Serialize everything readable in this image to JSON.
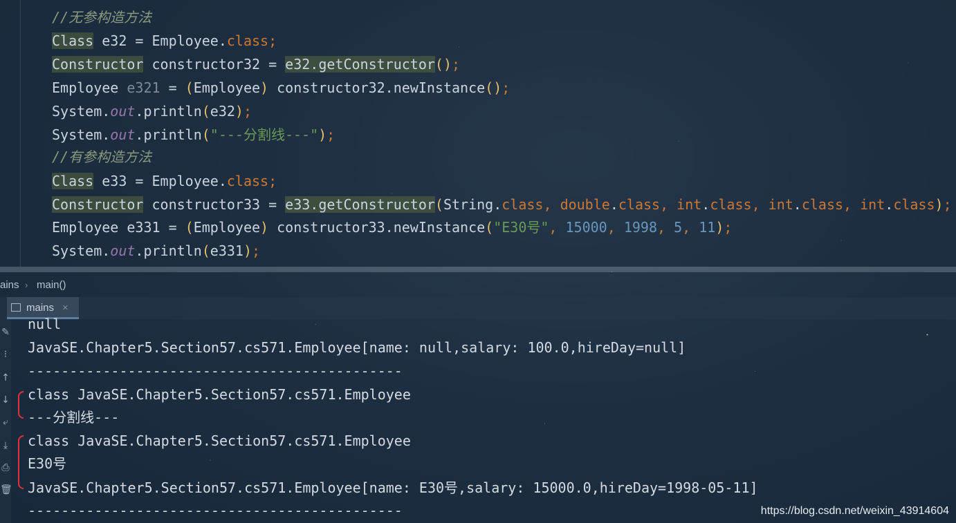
{
  "editor": {
    "lines": [
      {
        "segments": [
          {
            "t": "//无参构造方法",
            "c": "c-comment"
          }
        ]
      },
      {
        "segments": [
          {
            "t": "Class",
            "c": "c-class c-hl"
          },
          {
            "t": " e32 = Employee.",
            "c": ""
          },
          {
            "t": "class",
            "c": "c-kw"
          },
          {
            "t": ";",
            "c": "c-kw"
          }
        ]
      },
      {
        "segments": [
          {
            "t": "Constructor",
            "c": "c-class c-hl"
          },
          {
            "t": " constructor32 = ",
            "c": ""
          },
          {
            "t": "e32.getConstructor",
            "c": "c-hl"
          },
          {
            "t": "()",
            "c": "c-paren"
          },
          {
            "t": ";",
            "c": "c-kw"
          }
        ]
      },
      {
        "segments": [
          {
            "t": "Employee ",
            "c": ""
          },
          {
            "t": "e321",
            "c": "c-unused"
          },
          {
            "t": " = ",
            "c": ""
          },
          {
            "t": "(",
            "c": "c-paren"
          },
          {
            "t": "Employee",
            "c": ""
          },
          {
            "t": ")",
            "c": "c-paren"
          },
          {
            "t": " constructor32.newInstance",
            "c": ""
          },
          {
            "t": "()",
            "c": "c-paren"
          },
          {
            "t": ";",
            "c": "c-kw"
          }
        ]
      },
      {
        "segments": [
          {
            "t": "System.",
            "c": ""
          },
          {
            "t": "out",
            "c": "c-field"
          },
          {
            "t": ".println",
            "c": ""
          },
          {
            "t": "(",
            "c": "c-paren"
          },
          {
            "t": "e32",
            "c": ""
          },
          {
            "t": ")",
            "c": "c-paren"
          },
          {
            "t": ";",
            "c": "c-kw"
          }
        ]
      },
      {
        "segments": [
          {
            "t": "System.",
            "c": ""
          },
          {
            "t": "out",
            "c": "c-field"
          },
          {
            "t": ".println",
            "c": ""
          },
          {
            "t": "(",
            "c": "c-paren"
          },
          {
            "t": "\"---分割线---\"",
            "c": "c-str"
          },
          {
            "t": ")",
            "c": "c-paren"
          },
          {
            "t": ";",
            "c": "c-kw"
          }
        ]
      },
      {
        "segments": [
          {
            "t": "//有参构造方法",
            "c": "c-comment"
          }
        ]
      },
      {
        "segments": [
          {
            "t": "Class",
            "c": "c-class c-hl"
          },
          {
            "t": " e33 = Employee.",
            "c": ""
          },
          {
            "t": "class",
            "c": "c-kw"
          },
          {
            "t": ";",
            "c": "c-kw"
          }
        ]
      },
      {
        "segments": [
          {
            "t": "Constructor",
            "c": "c-class c-hl"
          },
          {
            "t": " constructor33 = ",
            "c": ""
          },
          {
            "t": "e33.getConstructor",
            "c": "c-hl"
          },
          {
            "t": "(",
            "c": "c-paren"
          },
          {
            "t": "String.",
            "c": ""
          },
          {
            "t": "class",
            "c": "c-kw"
          },
          {
            "t": ", ",
            "c": "c-kw"
          },
          {
            "t": "double",
            "c": "c-kw"
          },
          {
            "t": ".",
            "c": ""
          },
          {
            "t": "class",
            "c": "c-kw"
          },
          {
            "t": ", ",
            "c": "c-kw"
          },
          {
            "t": "int",
            "c": "c-kw"
          },
          {
            "t": ".",
            "c": ""
          },
          {
            "t": "class",
            "c": "c-kw"
          },
          {
            "t": ", ",
            "c": "c-kw"
          },
          {
            "t": "int",
            "c": "c-kw"
          },
          {
            "t": ".",
            "c": ""
          },
          {
            "t": "class",
            "c": "c-kw"
          },
          {
            "t": ", ",
            "c": "c-kw"
          },
          {
            "t": "int",
            "c": "c-kw"
          },
          {
            "t": ".",
            "c": ""
          },
          {
            "t": "class",
            "c": "c-kw"
          },
          {
            "t": ")",
            "c": "c-paren"
          },
          {
            "t": ";",
            "c": "c-kw"
          }
        ]
      },
      {
        "segments": [
          {
            "t": "Employee e331 = ",
            "c": ""
          },
          {
            "t": "(",
            "c": "c-paren"
          },
          {
            "t": "Employee",
            "c": ""
          },
          {
            "t": ")",
            "c": "c-paren"
          },
          {
            "t": " constructor33.newInstance",
            "c": ""
          },
          {
            "t": "(",
            "c": "c-paren"
          },
          {
            "t": "\"E30号\"",
            "c": "c-str"
          },
          {
            "t": ", ",
            "c": "c-kw"
          },
          {
            "t": "15000",
            "c": "c-num"
          },
          {
            "t": ", ",
            "c": "c-kw"
          },
          {
            "t": "1998",
            "c": "c-num"
          },
          {
            "t": ", ",
            "c": "c-kw"
          },
          {
            "t": "5",
            "c": "c-num"
          },
          {
            "t": ", ",
            "c": "c-kw"
          },
          {
            "t": "11",
            "c": "c-num"
          },
          {
            "t": ")",
            "c": "c-paren"
          },
          {
            "t": ";",
            "c": "c-kw"
          }
        ]
      },
      {
        "segments": [
          {
            "t": "System.",
            "c": ""
          },
          {
            "t": "out",
            "c": "c-field"
          },
          {
            "t": ".println",
            "c": ""
          },
          {
            "t": "(",
            "c": "c-paren"
          },
          {
            "t": "e331",
            "c": ""
          },
          {
            "t": ")",
            "c": "c-paren"
          },
          {
            "t": ";",
            "c": "c-kw"
          }
        ]
      }
    ]
  },
  "breadcrumb": {
    "items": [
      "ains",
      "main()"
    ],
    "separator": "›"
  },
  "run_panel": {
    "tab_label": "mains",
    "tab_close": "×",
    "toolbar_icons": [
      {
        "name": "edit-icon",
        "glyph": "✎"
      },
      {
        "name": "layout-icon",
        "glyph": "⁝"
      },
      {
        "name": "arrow-up-icon",
        "glyph": "↑"
      },
      {
        "name": "arrow-down-icon",
        "glyph": "↓"
      },
      {
        "name": "soft-wrap-icon",
        "glyph": "⤶"
      },
      {
        "name": "scroll-to-end-icon",
        "glyph": "⤓"
      },
      {
        "name": "print-icon",
        "glyph": "⎙"
      },
      {
        "name": "trash-icon",
        "glyph": "🗑"
      }
    ],
    "output_lines": [
      "null",
      "JavaSE.Chapter5.Section57.cs571.Employee[name: null,salary: 100.0,hireDay=null]",
      "---------------------------------------------",
      "class JavaSE.Chapter5.Section57.cs571.Employee",
      "---分割线---",
      "class JavaSE.Chapter5.Section57.cs571.Employee",
      "E30号",
      "JavaSE.Chapter5.Section57.cs571.Employee[name: E30号,salary: 15000.0,hireDay=1998-05-11]",
      "---------------------------------------------"
    ]
  },
  "watermark": "https://blog.csdn.net/weixin_43914604"
}
